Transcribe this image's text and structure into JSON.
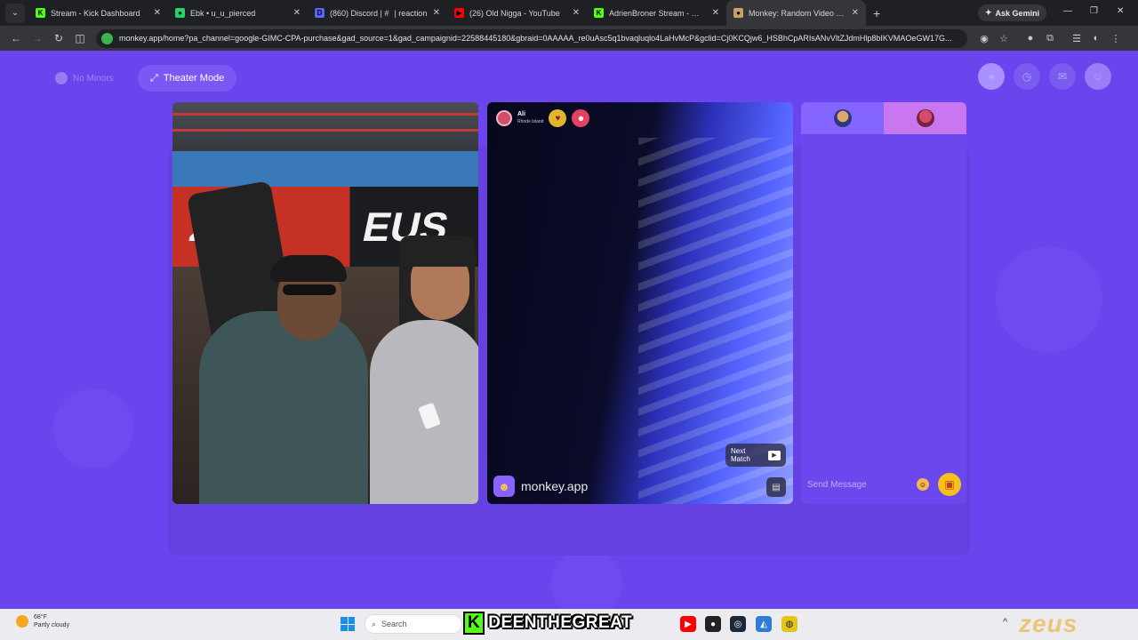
{
  "browser": {
    "tabs": [
      {
        "title": "Stream - Kick Dashboard",
        "fav_color": "#53fc18",
        "fav_glyph": "K",
        "active": false
      },
      {
        "title": "Ebk • u_u_pierced",
        "fav_color": "#25d366",
        "fav_glyph": "●",
        "active": false
      },
      {
        "title": "(860) Discord | #   | reaction",
        "fav_color": "#5865f2",
        "fav_glyph": "D",
        "active": false
      },
      {
        "title": "(26) Old Nigga - YouTube",
        "fav_color": "#ff0000",
        "fav_glyph": "▶",
        "active": false
      },
      {
        "title": "AdrienBroner Stream - Watch l",
        "fav_color": "#53fc18",
        "fav_glyph": "K",
        "active": false
      },
      {
        "title": "Monkey: Random Video Ch",
        "fav_color": "#c9a06b",
        "fav_glyph": "●",
        "active": true
      }
    ],
    "new_tab": "+",
    "ask_gemini": "Ask Gemini",
    "url": "monkey.app/home?pa_channel=google-GIMC-CPA-purchase&gad_source=1&gad_campaignid=22588445180&gbraid=0AAAAA_re0uAsc5q1bvaqluqlo4LaHvMcP&gclid=Cj0KCQjw6_HSBhCpARIsANvVltZJdmHlp8bIKVMAOeGW17G..."
  },
  "page": {
    "no_minors": "No Minors",
    "theater_mode": "Theater Mode",
    "remote_user": {
      "name": "Ali",
      "location": "Rhode Island"
    },
    "watermark": "monkey.app",
    "next_match": "Next Match",
    "send_message_placeholder": "Send Message"
  },
  "left_video": {
    "banner_left": "ze",
    "banner_right": "EUS"
  },
  "taskbar": {
    "temperature": "68°F",
    "weather": "Partly cloudy",
    "search": "Search",
    "overlay_name": "DEENTHEGREAT",
    "overlay_prefix": "K",
    "corner_logo": "zeus"
  }
}
